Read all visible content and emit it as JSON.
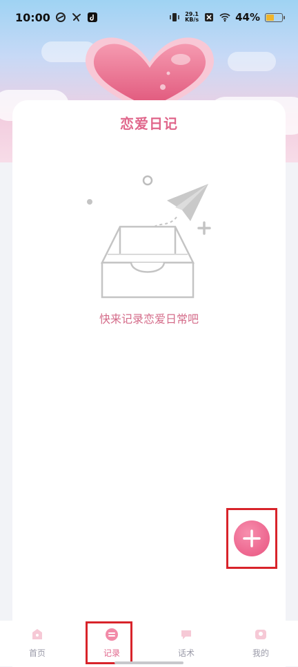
{
  "status": {
    "time": "10:00",
    "speed_value": "29.1",
    "speed_unit": "KB/s",
    "battery": "44%",
    "battery_level": 0.44
  },
  "page": {
    "title": "恋爱日记",
    "empty_message": "快来记录恋爱日常吧"
  },
  "fab": {
    "icon": "plus-icon"
  },
  "tabs": [
    {
      "label": "首页",
      "icon": "home-icon",
      "active": false
    },
    {
      "label": "记录",
      "icon": "record-icon",
      "active": true
    },
    {
      "label": "话术",
      "icon": "chat-icon",
      "active": false
    },
    {
      "label": "我的",
      "icon": "profile-icon",
      "active": false
    }
  ],
  "colors": {
    "accent": "#e0668b",
    "fab": "#ee6a92",
    "highlight_box": "#d8232a"
  }
}
